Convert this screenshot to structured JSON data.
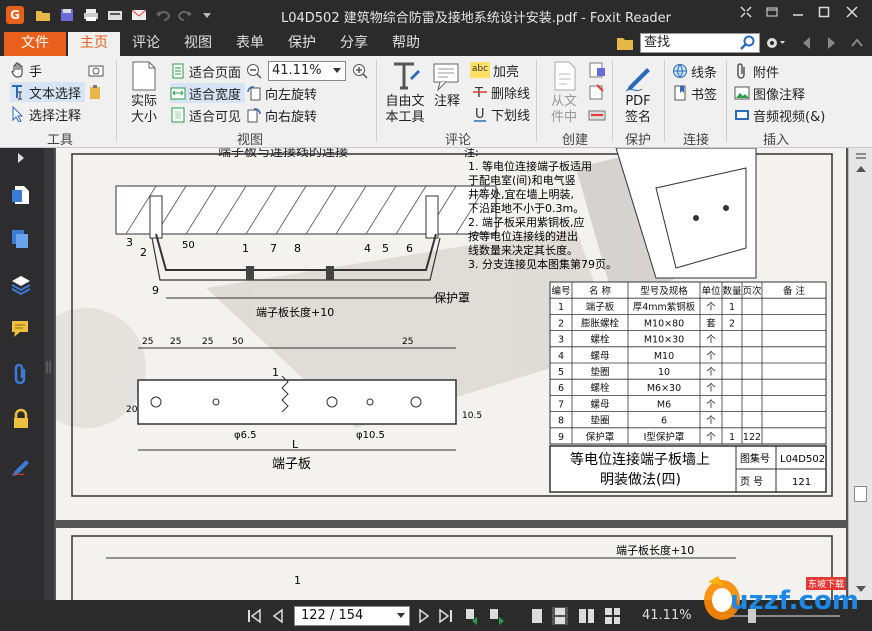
{
  "window": {
    "app_logo": "G",
    "title": "L04D502 建筑物综合防雷及接地系统设计安装.pdf - Foxit Reader"
  },
  "menu": {
    "tabs": [
      "文件",
      "主页",
      "评论",
      "视图",
      "表单",
      "保护",
      "分享",
      "帮助"
    ],
    "active_tab": "主页",
    "search_value": "查找"
  },
  "ribbon": {
    "tools": {
      "hand": "手",
      "select_text": "文本选择",
      "select_annotation": "选择注释",
      "group_label": "工具"
    },
    "actual_size_line1": "实际",
    "actual_size_line2": "大小",
    "view": {
      "fit_page": "适合页面",
      "fit_width": "适合宽度",
      "fit_visible": "适合可见",
      "zoom_value": "41.11%",
      "rotate_left": "向左旋转",
      "rotate_right": "向右旋转",
      "group_label": "视图"
    },
    "comment": {
      "typewriter_line1": "自由文",
      "typewriter_line2": "本工具",
      "note": "注释",
      "highlight": "加亮",
      "strikeout": "删除线",
      "underline": "下划线",
      "group_label": "评论",
      "highlight_badge": "abc"
    },
    "create": {
      "from_file_line1": "从文",
      "from_file_line2": "件中",
      "group_label": "创建"
    },
    "protect": {
      "pdf_sign_line1": "PDF",
      "pdf_sign_line2": "签名",
      "group_label": "保护"
    },
    "links": {
      "link": "线条",
      "bookmark": "书签",
      "group_label": "连接"
    },
    "insert": {
      "attachment": "附件",
      "image_annotation": "图像注释",
      "audio_video": "音频视频(&)",
      "group_label": "插入"
    }
  },
  "document": {
    "title_top": "端子板与连接线的连接",
    "notes_header": "注:",
    "notes": [
      "1. 等电位连接端子板适用",
      "   于配电室(间)和电气竖",
      "   井等处,宜在墙上明装,",
      "   下沿距地不小于0.3m。",
      "2. 端子板采用紫铜板,应",
      "   按等电位连接线的进出",
      "   线数量来决定其长度。",
      "3. 分支连接见本图集第79页。"
    ],
    "table_headers": [
      "编号",
      "名 称",
      "型号及规格",
      "单位",
      "数量",
      "页次",
      "备 注"
    ],
    "table_rows": [
      [
        "1",
        "端子板",
        "厚4mm紫铜板",
        "个",
        "1",
        "",
        ""
      ],
      [
        "2",
        "膨胀螺栓",
        "M10×80",
        "套",
        "2",
        "",
        ""
      ],
      [
        "3",
        "螺栓",
        "M10×30",
        "个",
        "",
        "",
        ""
      ],
      [
        "4",
        "螺母",
        "M10",
        "个",
        "",
        "",
        ""
      ],
      [
        "5",
        "垫圈",
        "10",
        "个",
        "",
        "",
        ""
      ],
      [
        "6",
        "螺栓",
        "M6×30",
        "个",
        "",
        "",
        ""
      ],
      [
        "7",
        "螺母",
        "M6",
        "个",
        "",
        "",
        ""
      ],
      [
        "8",
        "垫圈",
        "6",
        "个",
        "",
        "",
        ""
      ],
      [
        "9",
        "保护罩",
        "I型保护罩",
        "个",
        "1",
        "122",
        ""
      ]
    ],
    "title_block": {
      "name_line1": "等电位连接端子板墙上",
      "name_line2": "明装做法(四)",
      "atlas_label": "图集号",
      "atlas_value": "L04D502",
      "page_label": "页 号",
      "page_value": "121"
    },
    "labels": {
      "protect_cover": "保护罩",
      "board_length": "端子板长度+10",
      "board_name": "端子板",
      "hole_small": "φ6.5",
      "hole_large": "φ10.5",
      "dim_L": "L",
      "dim_50": "50",
      "dim_25": "25",
      "dim_20": "20",
      "dim_10_5": "10.5",
      "num_1": "1",
      "num_2": "2",
      "num_3": "3",
      "num_4": "4",
      "num_5": "5",
      "num_6": "6",
      "num_7": "7",
      "num_8": "8",
      "num_9": "9"
    },
    "page2": {
      "board_length": "端子板长度+10",
      "num_1": "1"
    }
  },
  "status": {
    "page_display": "122 / 154",
    "zoom": "41.11%"
  },
  "watermark": {
    "text": "uzzf.com",
    "badge": "东坡下载"
  },
  "colors": {
    "accent": "#e8601c",
    "dark": "#2b2b2b",
    "ribbon": "#f0f0f0"
  }
}
